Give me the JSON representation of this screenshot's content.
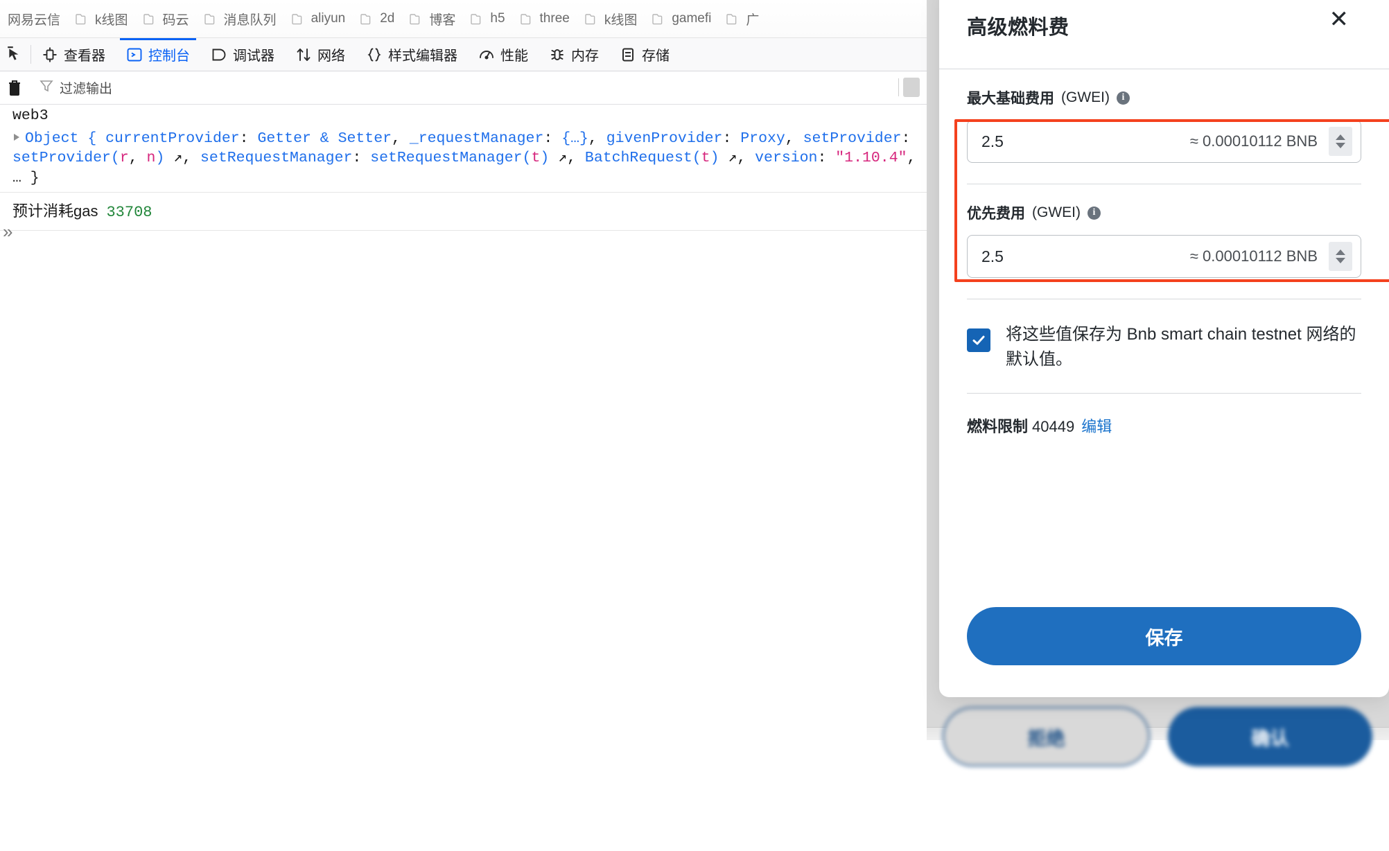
{
  "browser": {
    "bookmarks": [
      {
        "label": "网易云信",
        "icon": "folder-icon",
        "truncated": true
      },
      {
        "label": "k线图",
        "icon": "folder-icon"
      },
      {
        "label": "码云",
        "icon": "folder-icon"
      },
      {
        "label": "消息队列",
        "icon": "folder-icon"
      },
      {
        "label": "aliyun",
        "icon": "folder-icon"
      },
      {
        "label": "2d",
        "icon": "folder-icon"
      },
      {
        "label": "博客",
        "icon": "folder-icon"
      },
      {
        "label": "h5",
        "icon": "folder-icon"
      },
      {
        "label": "three",
        "icon": "folder-icon"
      },
      {
        "label": "k线图",
        "icon": "folder-icon"
      },
      {
        "label": "gamefi",
        "icon": "folder-icon"
      },
      {
        "label": "广",
        "icon": "folder-icon",
        "truncated": true
      }
    ]
  },
  "devtools": {
    "picker_icon": "element-picker-icon",
    "tabs": [
      {
        "label": "查看器",
        "icon": "inspector-icon",
        "active": false
      },
      {
        "label": "控制台",
        "icon": "console-icon",
        "active": true
      },
      {
        "label": "调试器",
        "icon": "debugger-icon",
        "active": false
      },
      {
        "label": "网络",
        "icon": "network-icon",
        "active": false
      },
      {
        "label": "样式编辑器",
        "icon": "style-editor-icon",
        "active": false
      },
      {
        "label": "性能",
        "icon": "performance-icon",
        "active": false
      },
      {
        "label": "内存",
        "icon": "memory-icon",
        "active": false
      },
      {
        "label": "存储",
        "icon": "storage-icon",
        "active": false
      }
    ],
    "active_accent": "#0a62f5",
    "filterbar": {
      "trash_icon": "trash-icon",
      "filter_icon": "filter-icon",
      "placeholder": "过滤输出"
    },
    "console": {
      "input_echo": "web3",
      "object_line": {
        "twisty": "disclosure-triangle-icon",
        "tokens": [
          {
            "t": "Object {",
            "c": "blue"
          },
          {
            "t": " currentProvider",
            "c": "blue"
          },
          {
            "t": ": ",
            "c": "dark"
          },
          {
            "t": "Getter & Setter",
            "c": "blue"
          },
          {
            "t": ", ",
            "c": "dark"
          },
          {
            "t": "_requestManager",
            "c": "blue"
          },
          {
            "t": ": ",
            "c": "dark"
          },
          {
            "t": "{…}",
            "c": "blue"
          },
          {
            "t": ", ",
            "c": "dark"
          },
          {
            "t": "givenProvider",
            "c": "blue"
          },
          {
            "t": ": ",
            "c": "dark"
          },
          {
            "t": "Proxy",
            "c": "blue"
          },
          {
            "t": ", ",
            "c": "dark"
          },
          {
            "t": "setProvider",
            "c": "blue"
          },
          {
            "t": ": ",
            "c": "dark"
          },
          {
            "t": "setProvider(",
            "c": "blue"
          },
          {
            "t": "r",
            "c": "pink"
          },
          {
            "t": ", ",
            "c": "dark"
          },
          {
            "t": "n",
            "c": "pink"
          },
          {
            "t": ")",
            "c": "blue"
          },
          {
            "t": " ↗",
            "c": "dark"
          },
          {
            "t": ", ",
            "c": "dark"
          },
          {
            "t": "setRequestManager",
            "c": "blue"
          },
          {
            "t": ": ",
            "c": "dark"
          },
          {
            "t": "setRequestManager(",
            "c": "blue"
          },
          {
            "t": "t",
            "c": "pink"
          },
          {
            "t": ")",
            "c": "blue"
          },
          {
            "t": " ↗",
            "c": "dark"
          },
          {
            "t": ", ",
            "c": "dark"
          },
          {
            "t": "BatchRequest(",
            "c": "blue"
          },
          {
            "t": "t",
            "c": "pink"
          },
          {
            "t": ")",
            "c": "blue"
          },
          {
            "t": " ↗",
            "c": "dark"
          },
          {
            "t": ", ",
            "c": "dark"
          },
          {
            "t": "version",
            "c": "blue"
          },
          {
            "t": ": ",
            "c": "dark"
          },
          {
            "t": "\"1.10.4\"",
            "c": "pink"
          },
          {
            "t": ", ",
            "c": "dark"
          },
          {
            "t": "…",
            "c": "dark"
          },
          {
            "t": " }",
            "c": "dark"
          }
        ]
      },
      "log_line": {
        "label": "预计消耗gas",
        "value": "33708",
        "value_color": "#22863a"
      },
      "expand_icon": "chevron-double-right-icon"
    }
  },
  "gas_modal": {
    "title": "高级燃料费",
    "close_icon": "close-icon",
    "highlight_color": "#f4411e",
    "fields": [
      {
        "label": "最大基础费用",
        "unit": "(GWEI)",
        "info_icon": "info-icon",
        "value": "2.5",
        "approx": "≈ 0.00010112 BNB",
        "stepper_icon": "stepper-up-down-icon"
      },
      {
        "label": "优先费用",
        "unit": "(GWEI)",
        "info_icon": "info-icon",
        "value": "2.5",
        "approx": "≈ 0.00010112 BNB",
        "stepper_icon": "stepper-up-down-icon"
      }
    ],
    "checkbox": {
      "checked": true,
      "icon": "checkmark-icon",
      "label": "将这些值保存为 Bnb smart chain testnet 网络的默认值。"
    },
    "gas_limit": {
      "label": "燃料限制",
      "value": "40449",
      "edit_label": "编辑"
    },
    "save_label": "保存",
    "save_color": "#1f6fbf"
  },
  "behind_modal": {
    "reject_label": "拒绝",
    "confirm_label": "确认"
  }
}
